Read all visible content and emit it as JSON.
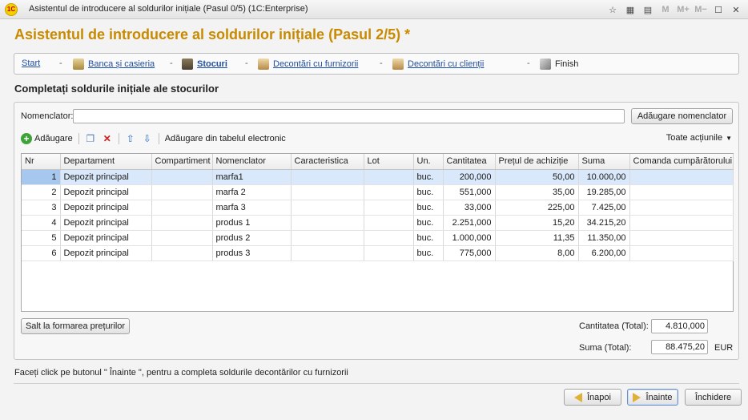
{
  "window": {
    "title": "Asistentul de introducere al soldurilor inițiale (Pasul 0/5)  (1C:Enterprise)",
    "app_icon": "1C",
    "buttons": {
      "m": "M",
      "mplus": "M+",
      "mminus": "M−"
    }
  },
  "page": {
    "heading": "Asistentul de introducere al soldurilor inițiale (Pasul 2/5) *",
    "subheading": "Completați soldurile inițiale ale stocurilor"
  },
  "steps": [
    {
      "label": "Start",
      "icon": "none"
    },
    {
      "label": "Banca și casieria",
      "icon": "bank-icon"
    },
    {
      "label": "Stocuri",
      "icon": "warehouse-icon",
      "current": true
    },
    {
      "label": "Decontări cu furnizorii",
      "icon": "supplier-icon"
    },
    {
      "label": "Decontări cu clienții",
      "icon": "client-icon"
    },
    {
      "label": "Finish",
      "icon": "finish-icon"
    }
  ],
  "step_separator": "-",
  "nomenclator": {
    "label": "Nomenclator:",
    "value": "",
    "add_button": "Adăugare nomenclator"
  },
  "toolbar": {
    "add": "Adăugare",
    "add_from_sheet": "Adăugare din tabelul electronic",
    "all_actions": "Toate acțiunile"
  },
  "table": {
    "columns": [
      "Nr",
      "Departament",
      "Compartiment",
      "Nomenclator",
      "Caracteristica",
      "Lot",
      "Un.",
      "Cantitatea",
      "Prețul de achiziție",
      "Suma",
      "Comanda cumpărătorului"
    ],
    "rows": [
      [
        "1",
        "Depozit principal",
        "",
        "marfa1",
        "",
        "",
        "buc.",
        "200,000",
        "50,00",
        "10.000,00",
        ""
      ],
      [
        "2",
        "Depozit principal",
        "",
        "marfa 2",
        "",
        "",
        "buc.",
        "551,000",
        "35,00",
        "19.285,00",
        ""
      ],
      [
        "3",
        "Depozit principal",
        "",
        "marfa 3",
        "",
        "",
        "buc.",
        "33,000",
        "225,00",
        "7.425,00",
        ""
      ],
      [
        "4",
        "Depozit principal",
        "",
        "produs 1",
        "",
        "",
        "buc.",
        "2.251,000",
        "15,20",
        "34.215,20",
        ""
      ],
      [
        "5",
        "Depozit principal",
        "",
        "produs 2",
        "",
        "",
        "buc.",
        "1.000,000",
        "11,35",
        "11.350,00",
        ""
      ],
      [
        "6",
        "Depozit principal",
        "",
        "produs 3",
        "",
        "",
        "buc.",
        "775,000",
        "8,00",
        "6.200,00",
        ""
      ]
    ],
    "selected_row": 0
  },
  "pricing_button": "Salt la formarea prețurilor",
  "totals": {
    "qty_label": "Cantitatea (Total):",
    "qty_value": "4.810,000",
    "sum_label": "Suma (Total):",
    "sum_value": "88.475,20",
    "currency": "EUR"
  },
  "status_text": "Faceți click pe butonul \" Înainte \", pentru a completa soldurile decontărilor cu furnizorii",
  "nav": {
    "back": "Înapoi",
    "next": "Înainte",
    "close": "Închidere"
  },
  "colors": {
    "heading": "#c98a00",
    "link": "#1f4fa8",
    "selection": "#d9e8fa"
  }
}
